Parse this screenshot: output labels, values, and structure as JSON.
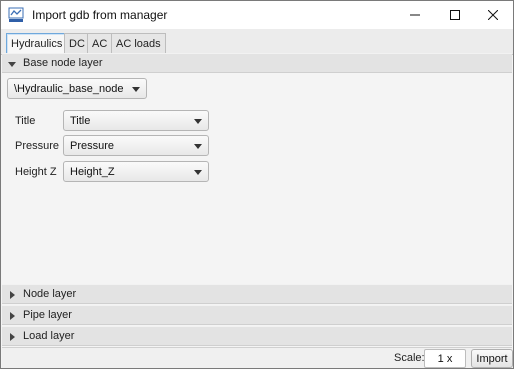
{
  "window": {
    "title": "Import gdb from manager",
    "app_icon": "gdb-manager-logo-icon",
    "controls": [
      "minimize-icon",
      "maximize-icon",
      "close-icon"
    ]
  },
  "tabs": [
    {
      "label": "Hydraulics",
      "active": true
    },
    {
      "label": "DC",
      "active": false
    },
    {
      "label": "AC",
      "active": false
    },
    {
      "label": "AC loads",
      "active": false
    }
  ],
  "base_node_layer": {
    "header": "Base node layer",
    "expanded": true,
    "layer_select": "\\Hydraulic_base_node",
    "fields": [
      {
        "label": "Title",
        "value": "Title"
      },
      {
        "label": "Pressure",
        "value": "Pressure"
      },
      {
        "label": "Height Z",
        "value": "Height_Z"
      }
    ]
  },
  "collapsed_sections": [
    {
      "header": "Node layer",
      "expanded": false
    },
    {
      "header": "Pipe layer",
      "expanded": false
    },
    {
      "header": "Load layer",
      "expanded": false
    }
  ],
  "footer": {
    "scale_label": "Scale:",
    "scale_value": "1 x",
    "import_label": "Import"
  },
  "colors": {
    "active_tab_border": "#6fa8dc",
    "section_header_bg": "#e3e3e3",
    "window_bg": "#f4f4f4"
  }
}
